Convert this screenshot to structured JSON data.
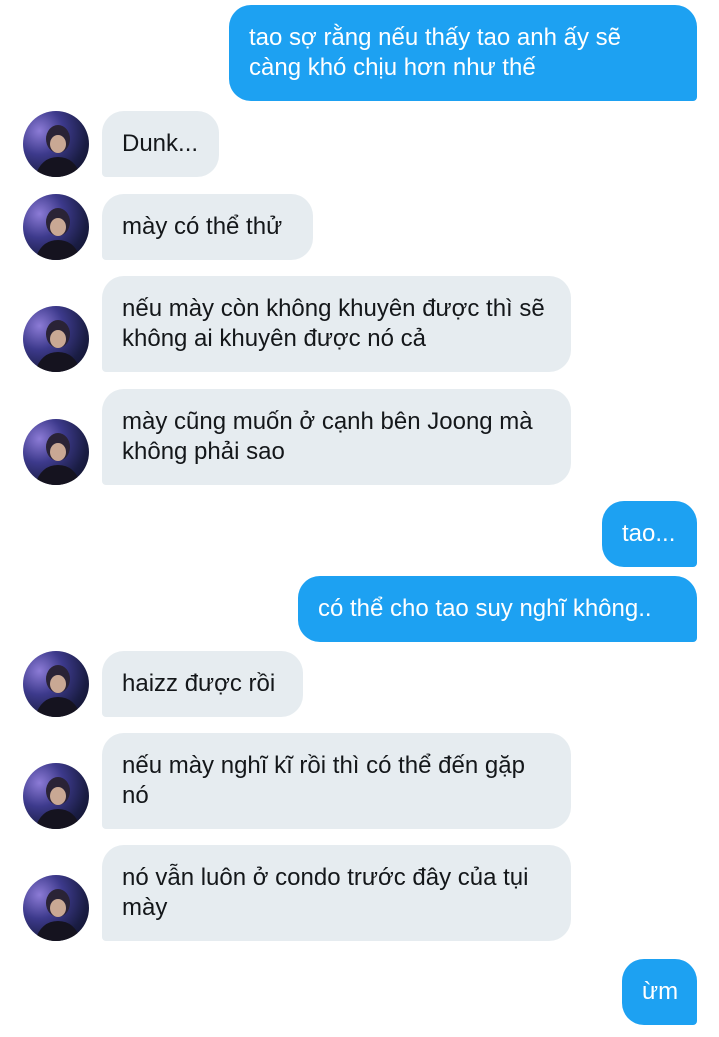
{
  "conversation": {
    "messages": [
      {
        "side": "sent",
        "text": "tao sợ rằng nếu thấy tao anh ấy sẽ càng khó chịu hơn như thế"
      },
      {
        "side": "received",
        "text": "Dunk..."
      },
      {
        "side": "received",
        "text": "mày có thể thử"
      },
      {
        "side": "received",
        "text": "nếu mày còn không khuyên được thì sẽ không ai khuyên được nó cả"
      },
      {
        "side": "received",
        "text": "mày cũng muốn ở cạnh bên Joong mà không phải sao"
      },
      {
        "side": "sent",
        "text": "tao..."
      },
      {
        "side": "sent",
        "text": "có thể cho tao suy nghĩ không.."
      },
      {
        "side": "received",
        "text": "haizz được rồi"
      },
      {
        "side": "received",
        "text": "nếu mày nghĩ kĩ rồi thì có thể đến gặp nó"
      },
      {
        "side": "received",
        "text": "nó vẫn luôn ở condo trước đây của tụi mày"
      },
      {
        "side": "sent",
        "text": "ừm"
      }
    ]
  },
  "colors": {
    "sent_bubble": "#1da1f2",
    "received_bubble": "#e6ecf0",
    "sent_text": "#ffffff",
    "received_text": "#14171a"
  },
  "icons": {
    "avatar": "contact-avatar-photo"
  }
}
